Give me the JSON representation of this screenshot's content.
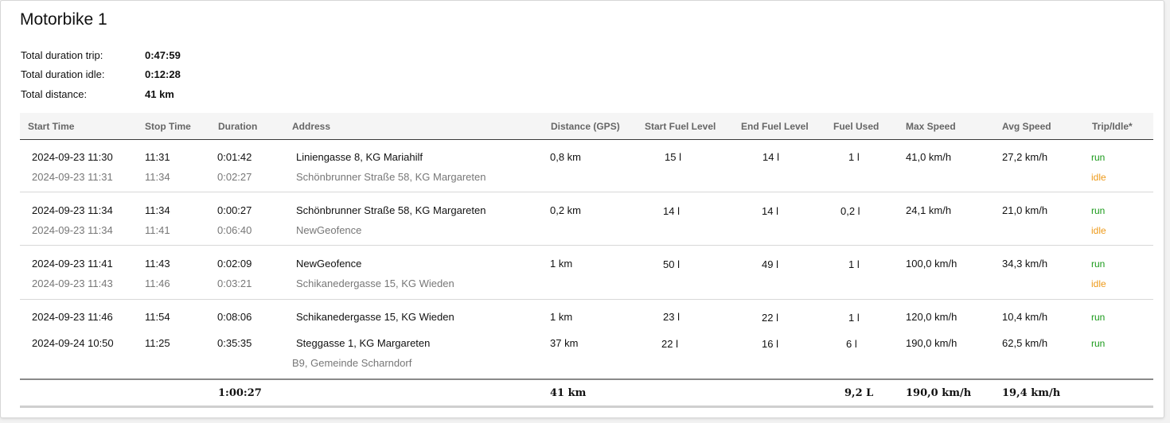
{
  "title": "Motorbike 1",
  "summary": [
    {
      "label": "Total duration trip:",
      "value": "0:47:59"
    },
    {
      "label": "Total duration idle:",
      "value": "0:12:28"
    },
    {
      "label": "Total distance:",
      "value": "41 km"
    }
  ],
  "columns": [
    "Start Time",
    "Stop Time",
    "Duration",
    "Address",
    "Distance (GPS)",
    "Start Fuel Level",
    "End Fuel Level",
    "Fuel Used",
    "Max Speed",
    "Avg Speed",
    "Trip/Idle*"
  ],
  "rows": [
    {
      "start": "2024-09-23 11:30",
      "stop": "11:31",
      "duration": "0:01:42",
      "address": "Liniengasse 8, KG Mariahilf",
      "distance": "0,8 km",
      "start_fuel": "15 l",
      "end_fuel": "14 l",
      "fuel_used": "1 l",
      "max_speed": "41,0 km/h",
      "avg_speed": "27,2 km/h",
      "type": "run"
    },
    {
      "start": "2024-09-23 11:31",
      "stop": "11:34",
      "duration": "0:02:27",
      "address": "Schönbrunner Straße 58, KG Margareten",
      "type": "idle"
    },
    {
      "start": "2024-09-23 11:34",
      "stop": "11:34",
      "duration": "0:00:27",
      "address": "Schönbrunner Straße 58, KG Margareten",
      "distance": "0,2 km",
      "start_fuel": "14 l",
      "end_fuel": "14 l",
      "fuel_used": "0,2 l",
      "max_speed": "24,1 km/h",
      "avg_speed": "21,0 km/h",
      "type": "run"
    },
    {
      "start": "2024-09-23 11:34",
      "stop": "11:41",
      "duration": "0:06:40",
      "address": "NewGeofence",
      "type": "idle"
    },
    {
      "start": "2024-09-23 11:41",
      "stop": "11:43",
      "duration": "0:02:09",
      "address": "NewGeofence",
      "distance": "1 km",
      "start_fuel": "50 l",
      "end_fuel": "49 l",
      "fuel_used": "1 l",
      "max_speed": "100,0 km/h",
      "avg_speed": "34,3 km/h",
      "type": "run"
    },
    {
      "start": "2024-09-23 11:43",
      "stop": "11:46",
      "duration": "0:03:21",
      "address": "Schikanedergasse 15, KG Wieden",
      "type": "idle"
    },
    {
      "start": "2024-09-23 11:46",
      "stop": "11:54",
      "duration": "0:08:06",
      "address": "Schikanedergasse 15, KG Wieden",
      "distance": "1 km",
      "start_fuel": "23 l",
      "end_fuel": "22 l",
      "fuel_used": "1 l",
      "max_speed": "120,0 km/h",
      "avg_speed": "10,4 km/h",
      "type": "run"
    },
    {
      "start": "2024-09-24 10:50",
      "stop": "11:25",
      "duration": "0:35:35",
      "address": "Steggasse 1, KG Margareten",
      "distance": "37 km",
      "start_fuel": "22 l",
      "end_fuel": "16 l",
      "fuel_used": "6 l",
      "max_speed": "190,0 km/h",
      "avg_speed": "62,5 km/h",
      "type": "run"
    }
  ],
  "end_address": "B9, Gemeinde Scharndorf",
  "totals": {
    "duration": "1:00:27",
    "distance": "41 km",
    "fuel_used": "9,2 L",
    "max_speed": "190,0 km/h",
    "avg_speed": "19,4 km/h"
  },
  "colors": {
    "run": "#1a9a1a",
    "idle": "#ee9a1a",
    "header_bg": "#f5f5f5"
  }
}
